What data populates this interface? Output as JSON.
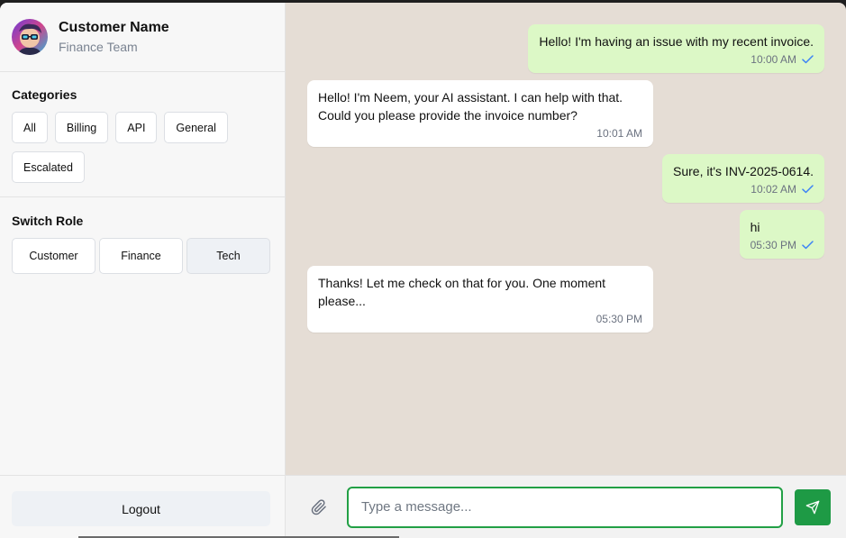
{
  "profile": {
    "name": "Customer Name",
    "team": "Finance Team"
  },
  "categories": {
    "title": "Categories",
    "items": [
      "All",
      "Billing",
      "API",
      "General",
      "Escalated"
    ]
  },
  "roles": {
    "title": "Switch Role",
    "items": [
      "Customer",
      "Finance",
      "Tech"
    ],
    "active": "Tech"
  },
  "sidebar": {
    "logout_label": "Logout"
  },
  "messages": [
    {
      "direction": "out",
      "text": "Hello! I'm having an issue with my recent invoice.",
      "time": "10:00 AM",
      "read": true
    },
    {
      "direction": "in",
      "text": "Hello! I'm Neem, your AI assistant. I can help with that. Could you please provide the invoice number?",
      "time": "10:01 AM"
    },
    {
      "direction": "out",
      "text": "Sure, it's INV-2025-0614.",
      "time": "10:02 AM",
      "read": true
    },
    {
      "direction": "out",
      "text": "hi",
      "time": "05:30 PM",
      "read": true
    },
    {
      "direction": "in",
      "text": "Thanks! Let me check on that for you. One moment please...",
      "time": "05:30 PM"
    }
  ],
  "composer": {
    "placeholder": "Type a message...",
    "value": ""
  },
  "colors": {
    "outgoing_bubble": "#dcf8c6",
    "incoming_bubble": "#ffffff",
    "chat_background": "#e5ddd5",
    "accent": "#1e9a45",
    "read_tick": "#3b82f6"
  },
  "icons": {
    "avatar": "avatar-image",
    "attach": "paperclip-icon",
    "send": "send-icon",
    "read": "check-icon"
  }
}
